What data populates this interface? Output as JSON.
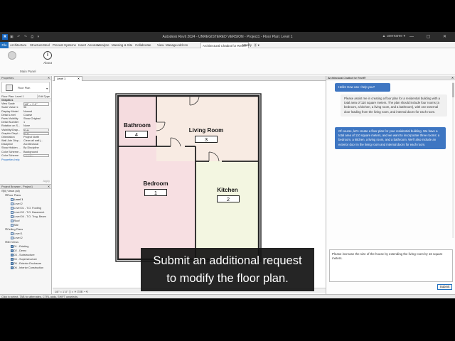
{
  "window": {
    "title": "Autodesk Revit 2024 - UNREGISTERED VERSION - Project1 - Floor Plan: Level 1",
    "app_letter": "R",
    "qat_icons": "▣ ↶ ↷ ⎙ ▾",
    "user": "▲ username ▾",
    "window_buttons": "— ▢ ✕"
  },
  "ribbon": {
    "tabs": [
      "File",
      "Architecture",
      "Structure",
      "Steel",
      "Precast",
      "Systems",
      "Insert",
      "Annotate",
      "Analyze",
      "Massing & Site",
      "Collaborate",
      "View",
      "Manage",
      "Add-Ins",
      "Architectural Chatbot for Revit®",
      "Modify",
      "⦿ ▾"
    ],
    "active_tab": "Architectural Chatbot for Revit®",
    "buttons": [
      {
        "label": "",
        "icon": "chatbot-icon",
        "color": "#c8c8c8"
      },
      {
        "label": "About",
        "icon": "info-icon",
        "color": "#555555"
      }
    ],
    "panel_label": "Main Panel"
  },
  "properties": {
    "header": "Properties",
    "type_name": "Floor Plan",
    "instance": "Floor Plan: Level 1",
    "edit_type": "Edit Type",
    "section": "Graphics",
    "rows": [
      {
        "k": "View Scale",
        "v": "1/8\" = 1'-0\"",
        "boxed": true
      },
      {
        "k": "Scale Value  1:",
        "v": "96"
      },
      {
        "k": "Display Model",
        "v": "Normal"
      },
      {
        "k": "Detail Level",
        "v": "Coarse"
      },
      {
        "k": "Parts Visibility",
        "v": "Show Original"
      },
      {
        "k": "Detail Number",
        "v": "1"
      },
      {
        "k": "Rotation on S...",
        "v": "None"
      },
      {
        "k": "Visibility/Grap...",
        "v": "Edit...",
        "boxed": true
      },
      {
        "k": "Graphic Displ...",
        "v": "Edit...",
        "boxed": true
      },
      {
        "k": "Orientation",
        "v": "Project North"
      },
      {
        "k": "Wall Join Disp...",
        "v": "Clean all wall j..."
      },
      {
        "k": "Discipline",
        "v": "Architectural"
      },
      {
        "k": "Show Hidden ...",
        "v": "By Discipline"
      },
      {
        "k": "Color Scheme ...",
        "v": "Background"
      },
      {
        "k": "Color Scheme",
        "v": "<none>",
        "boxed": true
      }
    ],
    "help": "Properties help",
    "apply": "Apply"
  },
  "browser": {
    "header": "Project Browser - Project1",
    "nodes": [
      {
        "indent": 0,
        "tw": "⊟",
        "icon": "",
        "label": "[0] Views (all)"
      },
      {
        "indent": 1,
        "tw": "⊟",
        "icon": "",
        "label": "Floor Plans"
      },
      {
        "indent": 2,
        "tw": "",
        "icon": "plan",
        "label": "Level 1",
        "selected": true
      },
      {
        "indent": 2,
        "tw": "",
        "icon": "plan",
        "label": "Level 2"
      },
      {
        "indent": 2,
        "tw": "",
        "icon": "plan",
        "label": "Level 01 - T.O. Footing"
      },
      {
        "indent": 2,
        "tw": "",
        "icon": "plan",
        "label": "Level 02 - T.O. Basement"
      },
      {
        "indent": 2,
        "tw": "",
        "icon": "plan",
        "label": "Level 04 - T.O. Trog. Beam"
      },
      {
        "indent": 2,
        "tw": "",
        "icon": "plan",
        "label": "Roof"
      },
      {
        "indent": 2,
        "tw": "",
        "icon": "plan",
        "label": "Site"
      },
      {
        "indent": 1,
        "tw": "⊟",
        "icon": "",
        "label": "Ceiling Plans"
      },
      {
        "indent": 2,
        "tw": "",
        "icon": "plan",
        "label": "Level 1"
      },
      {
        "indent": 2,
        "tw": "",
        "icon": "plan",
        "label": "Level 2"
      },
      {
        "indent": 1,
        "tw": "⊟",
        "icon": "",
        "label": "3D Views"
      },
      {
        "indent": 2,
        "tw": "",
        "icon": "three",
        "label": "01 - Existing"
      },
      {
        "indent": 2,
        "tw": "",
        "icon": "three",
        "label": "02 - Demo"
      },
      {
        "indent": 2,
        "tw": "",
        "icon": "three",
        "label": "03 - Substructure"
      },
      {
        "indent": 2,
        "tw": "",
        "icon": "three",
        "label": "04 - Superstructure"
      },
      {
        "indent": 2,
        "tw": "",
        "icon": "three",
        "label": "05 - Exterior Enclosure"
      },
      {
        "indent": 2,
        "tw": "",
        "icon": "three",
        "label": "06 - Interior Construction"
      }
    ]
  },
  "view_tab": {
    "label": "Level 1",
    "close": "✕"
  },
  "view_control": {
    "scale": "1/8\" = 1'-0\"   ◻ ◐ ☀ ⊡ ⊞ ◔ ⟲"
  },
  "floor_plan": {
    "rooms": [
      {
        "name": "Bathroom",
        "number": "4",
        "fill": "#f5dcdf"
      },
      {
        "name": "Living Room",
        "number": "3",
        "fill": "#f8ebe3"
      },
      {
        "name": "Bedroom",
        "number": "1",
        "fill": "#f7dfe2"
      },
      {
        "name": "Kitchen",
        "number": "2",
        "fill": "#f3f6e1"
      }
    ]
  },
  "chat": {
    "header": "Architectural Chatbot for Revit®",
    "messages": [
      {
        "role": "bot",
        "text": "Hello! How can I help you?"
      },
      {
        "role": "user",
        "text": "Please assist me in creating a floor plan for a residential building with a total area of 110 square meters. The plan should include four rooms (a bedroom, a kitchen, a living room, and a bathroom), with one external door leading from the living room, and internal doors for each room."
      },
      {
        "role": "bot",
        "text": "Of course, let's create a floor plan for your residential building. We have a total area of 110 square meters, and we want to incorporate three rooms: a bedroom, a kitchen, a living room, and a bathroom. We'll also include an exterior door in the living room and internal doors for each room."
      }
    ],
    "input_value": "Please increase the size of the house by extending the living room by 16 square meters.",
    "submit_label": "Submit"
  },
  "status_bar": {
    "text": "Click to select, TAB for alternates, CTRL adds, SHIFT unselects."
  },
  "caption": {
    "line1": "Submit an additional request",
    "line2": "to modify the floor plan."
  }
}
